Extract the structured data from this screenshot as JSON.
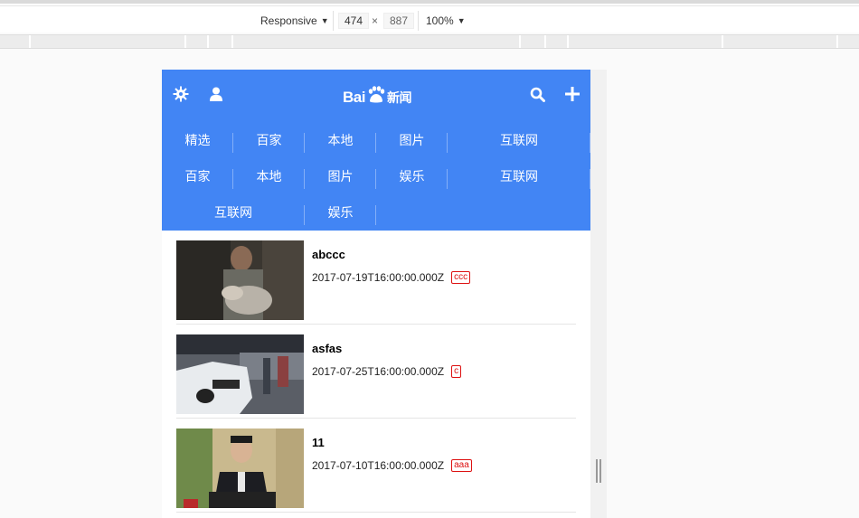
{
  "devtools": {
    "device": "Responsive",
    "width": "474",
    "height": "887",
    "times": "×",
    "zoom": "100%"
  },
  "header": {
    "logo_text_left": "Bai",
    "logo_text_right": "新闻",
    "icons": [
      "gear-icon",
      "user-icon",
      "search-icon",
      "plus-icon"
    ],
    "color": "#4285f4"
  },
  "nav": {
    "rows": [
      [
        "精选",
        "百家",
        "本地",
        "图片",
        "互联网"
      ],
      [
        "百家",
        "本地",
        "图片",
        "娱乐",
        "互联网"
      ],
      [
        "互联网",
        "娱乐"
      ]
    ]
  },
  "news": [
    {
      "title": "abccc",
      "date": "2017-07-19T16:00:00.000Z",
      "tag": "ccc"
    },
    {
      "title": "asfas",
      "date": "2017-07-25T16:00:00.000Z",
      "tag": "c"
    },
    {
      "title": "11",
      "date": "2017-07-10T16:00:00.000Z",
      "tag": "aaa"
    }
  ]
}
